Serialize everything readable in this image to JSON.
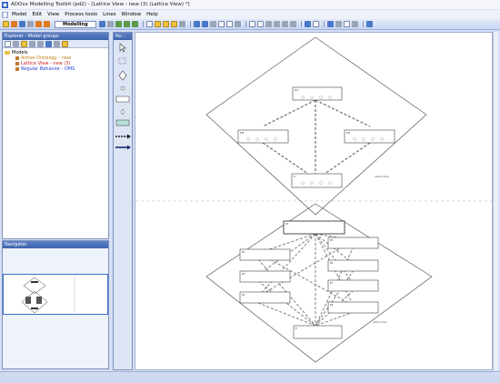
{
  "window": {
    "title": "ADOxx Modelling Toolkit (pd2) - [Lattice View - new (3) (Lattice View) *]"
  },
  "menu": [
    "Model",
    "Edit",
    "View",
    "Process tools",
    "Lines",
    "Window",
    "Help"
  ],
  "toolbar": {
    "mode_label": "Modelling"
  },
  "explorer": {
    "header": "Explorer - Model groups",
    "tree": [
      {
        "label": "Models",
        "color": "#000000"
      },
      {
        "label": "Active Ontology - new",
        "color": "#c47a14"
      },
      {
        "label": "Lattice View - new (3)",
        "color": "#d42020"
      },
      {
        "label": "Regular Behavior - DMS",
        "color": "#2040c8"
      }
    ]
  },
  "navigator": {
    "header": "Navigator"
  },
  "palette": {
    "header": "Mo..."
  },
  "canvas": {
    "top_diagram": {
      "caption": "Lattice View",
      "nodes": [
        {
          "id": "top",
          "label": "Ei1"
        },
        {
          "id": "left",
          "label": "Ei2"
        },
        {
          "id": "right",
          "label": "Ei3"
        },
        {
          "id": "bottom",
          "label": "E"
        }
      ]
    },
    "bottom_diagram": {
      "caption": "Lattice View",
      "nodes": [
        {
          "id": "t",
          "label": "E1"
        },
        {
          "id": "l1",
          "label": "E2"
        },
        {
          "id": "l2",
          "label": "E3"
        },
        {
          "id": "l3",
          "label": "E4"
        },
        {
          "id": "r1",
          "label": "E5"
        },
        {
          "id": "r2",
          "label": "E6"
        },
        {
          "id": "r3",
          "label": "E7"
        },
        {
          "id": "r4",
          "label": "E8"
        },
        {
          "id": "b",
          "label": "E"
        }
      ]
    }
  },
  "colors": {
    "titlebar": "#f4f6fb",
    "panel_header": "#4a6fb8",
    "window_bg": "#d6dff7"
  }
}
